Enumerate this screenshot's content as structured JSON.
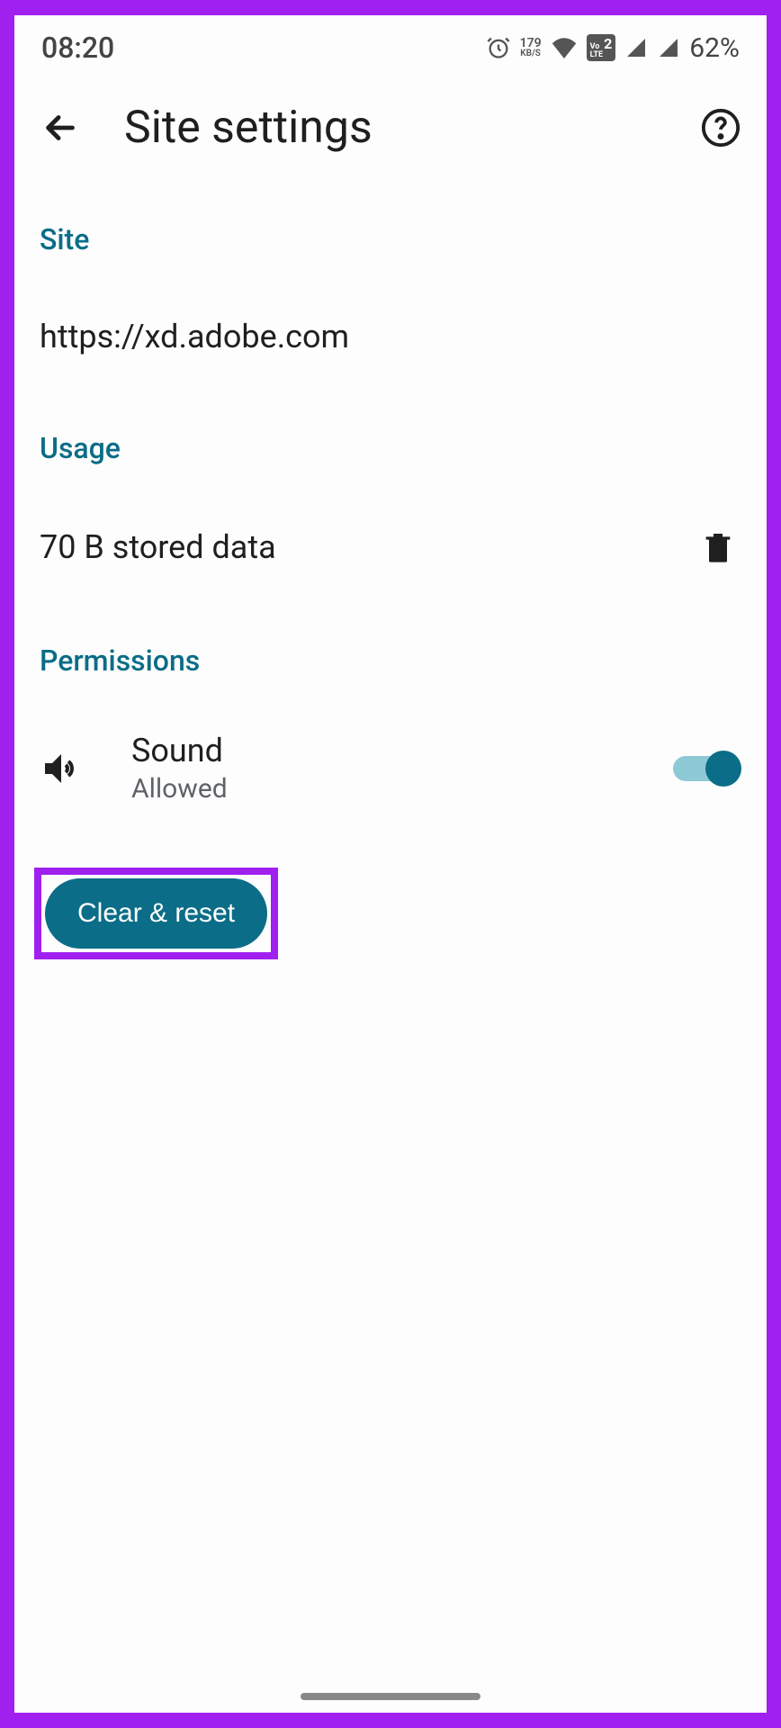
{
  "status": {
    "time": "08:20",
    "kbs_top": "179",
    "kbs_bottom": "KB/S",
    "volte_top": "Vo",
    "volte_bottom": "LTE",
    "volte_num": "2",
    "battery": "62%"
  },
  "header": {
    "title": "Site settings"
  },
  "site": {
    "section_label": "Site",
    "url": "https://xd.adobe.com"
  },
  "usage": {
    "section_label": "Usage",
    "stored": "70 B stored data"
  },
  "permissions": {
    "section_label": "Permissions",
    "items": [
      {
        "name": "Sound",
        "status": "Allowed",
        "enabled": true
      }
    ]
  },
  "actions": {
    "clear_reset": "Clear & reset"
  },
  "colors": {
    "accent": "#0b6d87",
    "highlight": "#a020f0"
  }
}
